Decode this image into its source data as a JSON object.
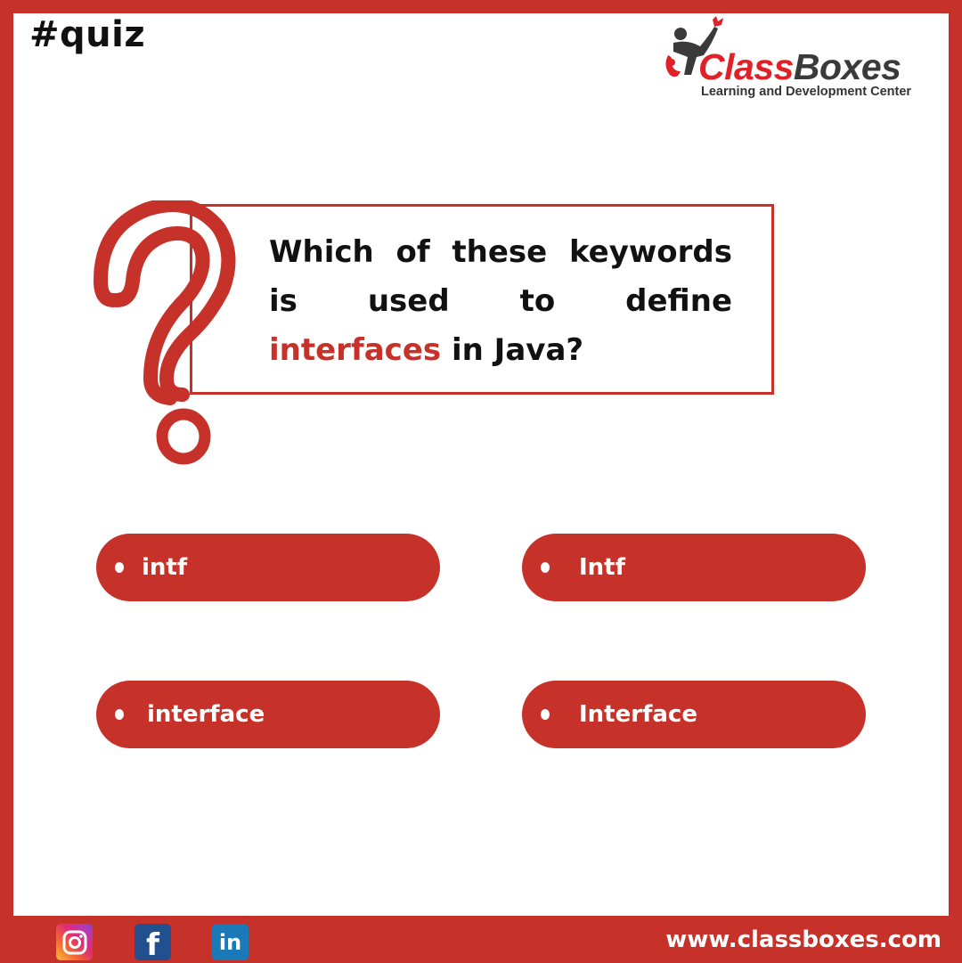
{
  "hashtag": "#quiz",
  "logo": {
    "brand_part1": "Class",
    "brand_part2": "Boxes",
    "tagline": "Learning and Development Center"
  },
  "question": {
    "prefix": "Which of these keywords is used to define",
    "highlight": "interfaces",
    "suffix": "in Java?"
  },
  "options": [
    {
      "label": "intf"
    },
    {
      "label": "Intf"
    },
    {
      "label": "interface"
    },
    {
      "label": "Interface"
    }
  ],
  "footer": {
    "social": [
      "instagram-icon",
      "facebook-icon",
      "linkedin-icon"
    ],
    "facebook_glyph": "f",
    "linkedin_glyph": "in",
    "website": "www.classboxes.com"
  },
  "colors": {
    "accent": "#c6322a",
    "brand_red": "#e02128",
    "brand_dark": "#3a3a3a"
  }
}
